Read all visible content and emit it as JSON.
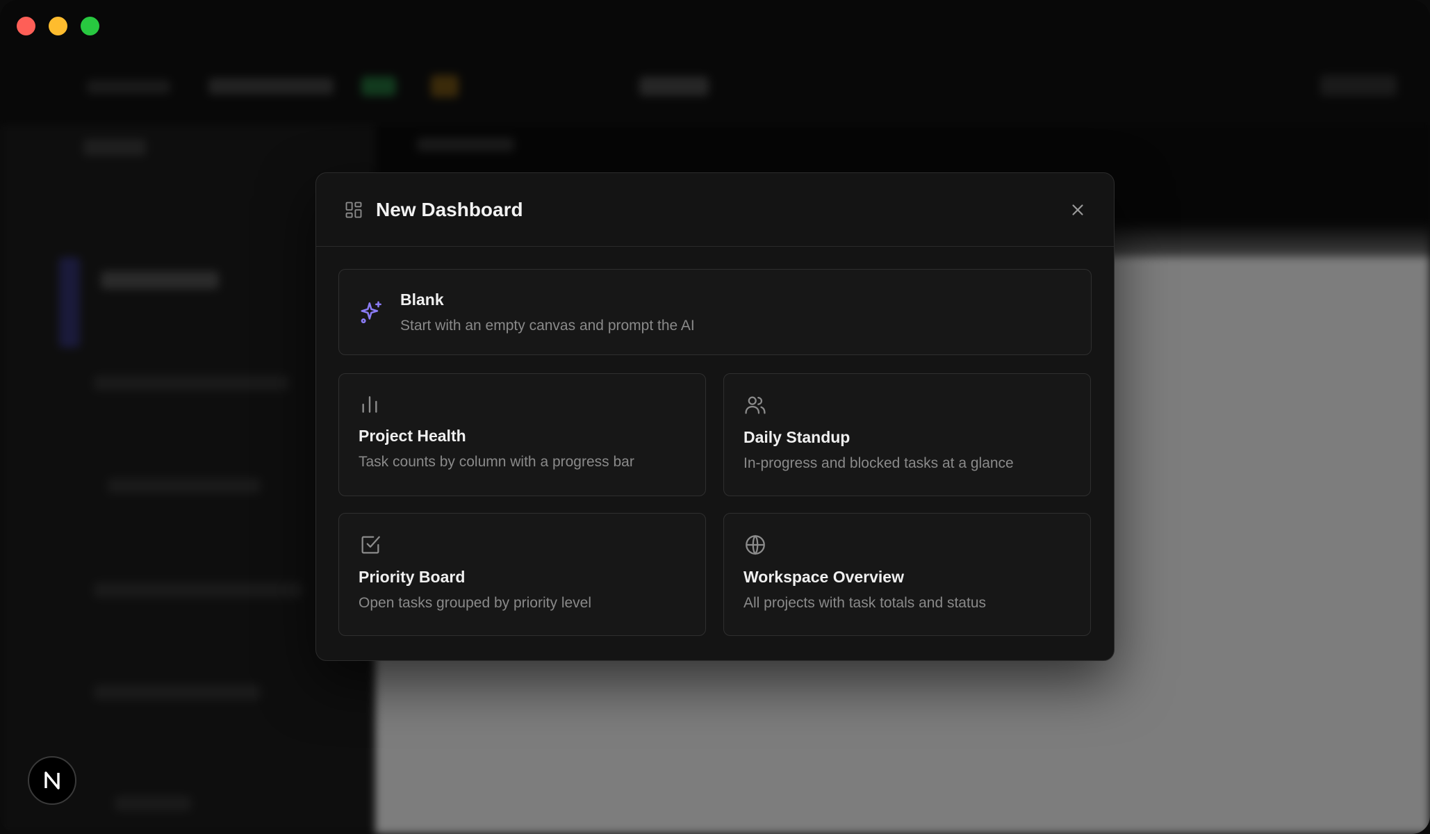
{
  "window": {
    "traffic_lights": [
      "close",
      "minimize",
      "maximize"
    ],
    "badge_letter": "N"
  },
  "modal": {
    "title": "New Dashboard",
    "title_icon": "layout-grid-icon",
    "close_icon": "close-icon",
    "blank": {
      "title": "Blank",
      "description": "Start with an empty canvas and prompt the AI",
      "icon": "sparkles-icon",
      "accent": "#8b7cf6"
    },
    "templates": [
      {
        "title": "Project Health",
        "description": "Task counts by column with a progress bar",
        "icon": "bar-chart-icon"
      },
      {
        "title": "Daily Standup",
        "description": "In-progress and blocked tasks at a glance",
        "icon": "users-icon"
      },
      {
        "title": "Priority Board",
        "description": "Open tasks grouped by priority level",
        "icon": "check-square-icon"
      },
      {
        "title": "Workspace Overview",
        "description": "All projects with task totals and status",
        "icon": "globe-icon"
      }
    ]
  }
}
